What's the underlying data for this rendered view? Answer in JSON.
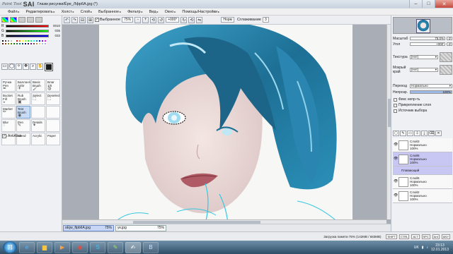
{
  "app": {
    "logo_mark": "Paint Tool",
    "logo_name": "SAI",
    "document_title": "Глазм рисунки/Ёре_Лфр6А.jpg (*)"
  },
  "menu": [
    {
      "label": "Файл",
      "arrow": "▸"
    },
    {
      "label": "Редактировать",
      "arrow": "▸"
    },
    {
      "label": "Холст",
      "arrow": "▸"
    },
    {
      "label": "Слой",
      "arrow": "▸"
    },
    {
      "label": "Выбранное",
      "arrow": "▸"
    },
    {
      "label": "Фильтр",
      "arrow": "▸"
    },
    {
      "label": "Вид",
      "arrow": "▸"
    },
    {
      "label": "Окно",
      "arrow": "▸"
    },
    {
      "label": "Помощь/Настройки",
      "arrow": "▸"
    }
  ],
  "toolbar": {
    "selection_label": "Выбранное",
    "zoom": "75%",
    "angle": "+000°",
    "normal_label": "Норм",
    "stabilizer_label": "Сглаживание",
    "stabilizer_value": "3"
  },
  "color_panel": {
    "sliders": [
      {
        "label": "R",
        "value": "0010",
        "color": "#e02020"
      },
      {
        "label": "G",
        "value": "035",
        "color": "#20c020"
      },
      {
        "label": "B",
        "value": "032",
        "color": "#2040e0"
      }
    ],
    "swatches": [
      "#000000",
      "#404040",
      "#808080",
      "#c0c0c0",
      "#ffffff",
      "#ff0000",
      "#ff8000",
      "#ffff00",
      "#80ff00",
      "#00ff00",
      "#00ff80",
      "#00ffff",
      "#0080ff",
      "#0000ff",
      "#8000ff",
      "#ff00ff",
      "#800000",
      "#804000",
      "#808000",
      "#408000",
      "#008000",
      "#008040",
      "#008080",
      "#004080",
      "#000080",
      "#400080",
      "#800080",
      "#804040",
      "#c08060",
      "#e0c0a0",
      "#a0c0e0",
      "#c0a0e0"
    ]
  },
  "tools": [
    {
      "label": "Ручка",
      "sub": "Pen",
      "icon": "✒",
      "selected": false
    },
    {
      "label": "Баллонч",
      "sub": "Airbr",
      "icon": "✈",
      "selected": false
    },
    {
      "label": "Basic",
      "sub": "Brush",
      "icon": "🖌",
      "selected": false
    },
    {
      "label": "Влаг",
      "sub": "1/0",
      "icon": "◍",
      "selected": false
    },
    {
      "label": "Bucket",
      "sub": "Fill",
      "icon": "◒",
      "selected": false
    },
    {
      "label": "Rub",
      "sub": "Brush",
      "icon": "▣",
      "selected": false
    },
    {
      "label": "Select",
      "sub": "",
      "icon": "⬚",
      "selected": false
    },
    {
      "label": "Deselect",
      "sub": "",
      "icon": "⬚",
      "selected": false
    },
    {
      "label": "Marker",
      "sub": "",
      "icon": "✏",
      "selected": false
    },
    {
      "label": "Test",
      "sub": "Brush",
      "icon": "◉",
      "selected": true
    },
    {
      "label": "",
      "sub": "",
      "icon": "",
      "selected": false
    },
    {
      "label": "",
      "sub": "",
      "icon": "",
      "selected": false
    },
    {
      "label": "Blur",
      "sub": "",
      "icon": "◌",
      "selected": false
    },
    {
      "label": "Pen",
      "sub": "",
      "icon": "✎",
      "selected": false
    },
    {
      "label": "Details",
      "sub": "",
      "icon": "✦",
      "selected": false
    },
    {
      "label": "",
      "sub": "",
      "icon": "",
      "selected": false
    },
    {
      "label": "Ink",
      "sub": "",
      "icon": "",
      "selected": false
    },
    {
      "label": "Blend",
      "sub": "",
      "icon": "",
      "selected": false
    },
    {
      "label": "Acrylic",
      "sub": "",
      "icon": "",
      "selected": false
    },
    {
      "label": "Paper",
      "sub": "",
      "icon": "",
      "selected": false
    }
  ],
  "antialias_label": "AntiAlias",
  "right_panel": {
    "scale_label": "Масштаб",
    "scale_value": "75.0%",
    "angle_label": "Угол",
    "angle_value": "+000'",
    "texture_label": "Текстура",
    "texture_value": "[Нет]",
    "edge_label": "Мокрый край",
    "edge_value": "[Нет]",
    "mode_label": "Переход",
    "mode_value": "Нормально",
    "opacity_label": "Непрозр.",
    "opacity_value": "100%",
    "checks": [
      "Фикс непр-ть",
      "Прикрепление слоя",
      "Источник выбора"
    ],
    "layers": [
      {
        "name": "Слой3",
        "mode": "Нормально",
        "opacity": "100%",
        "selected": false
      },
      {
        "name": "Слой6",
        "mode": "Нормально",
        "opacity": "100%",
        "selected": true
      },
      {
        "name": "Плавающий",
        "mode": "",
        "opacity": "",
        "selected": true,
        "sub": true
      },
      {
        "name": "Слой5",
        "mode": "Нормально",
        "opacity": "100%",
        "selected": false
      },
      {
        "name": "Слой2",
        "mode": "Нормально",
        "opacity": "100%",
        "selected": false
      }
    ]
  },
  "doc_tabs": [
    {
      "name": "sEjw_ftpb6A.jpg",
      "zoom": "75%",
      "active": true
    },
    {
      "name": "yк.jpg",
      "zoom": "75%",
      "active": false
    }
  ],
  "status": {
    "text": "Загрузка памяти 75% (142MB / 683MB)",
    "indicators": [
      "SHIFT",
      "CTRL",
      "ALT",
      "SPC",
      "Ant",
      "ANY"
    ]
  },
  "taskbar": {
    "apps": [
      "ie-icon",
      "folder-icon",
      "media-icon",
      "chrome-icon",
      "skype-icon",
      "paint-icon",
      "sai-icon",
      "vk-icon"
    ],
    "lang": "UK",
    "time": "23:13",
    "date": "12.01.2013"
  }
}
